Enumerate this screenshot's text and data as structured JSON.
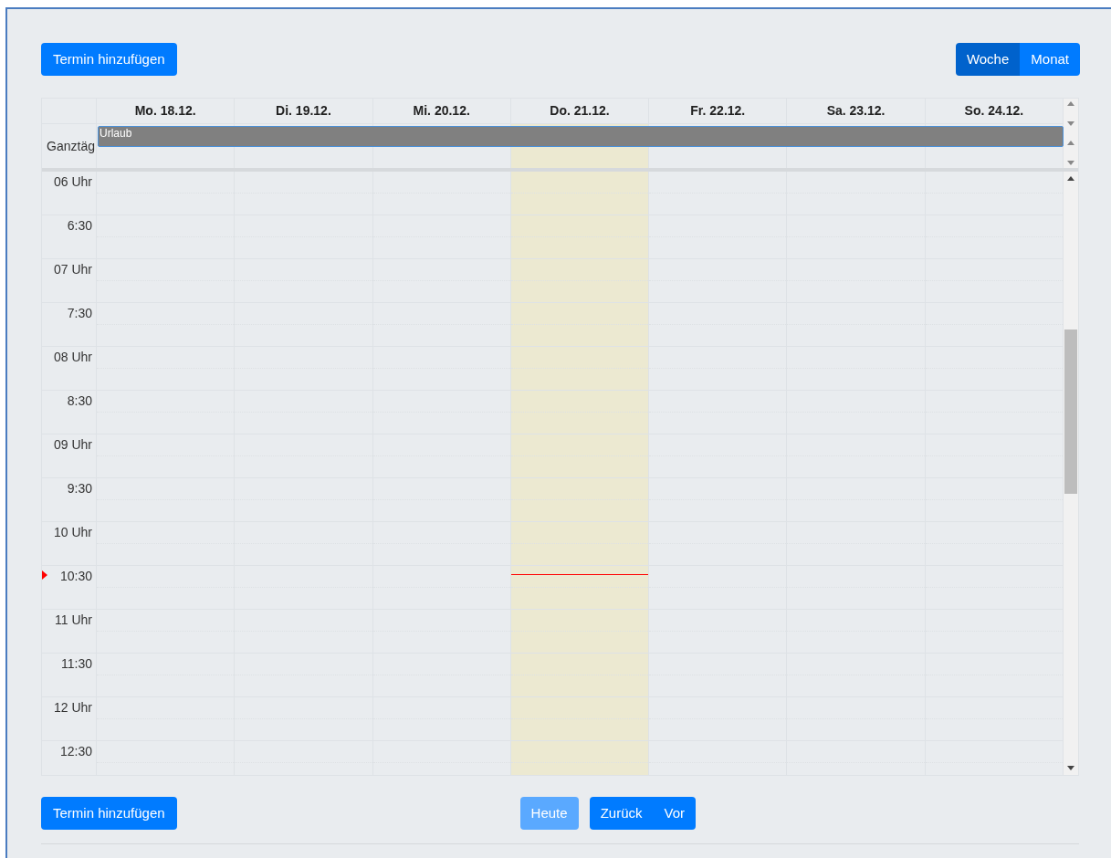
{
  "toolbar_top": {
    "add_button": "Termin hinzufügen",
    "views": [
      {
        "label": "Woche",
        "selected": true
      },
      {
        "label": "Monat",
        "selected": false
      }
    ]
  },
  "calendar": {
    "days": [
      {
        "label": "Mo. 18.12.",
        "today": false
      },
      {
        "label": "Di. 19.12.",
        "today": false
      },
      {
        "label": "Mi. 20.12.",
        "today": false
      },
      {
        "label": "Do. 21.12.",
        "today": true
      },
      {
        "label": "Fr. 22.12.",
        "today": false
      },
      {
        "label": "Sa. 23.12.",
        "today": false
      },
      {
        "label": "So. 24.12.",
        "today": false
      }
    ],
    "all_day_label": "Ganztäg",
    "all_day_events": [
      {
        "title": "Urlaub"
      }
    ],
    "slots": [
      {
        "label": "06 Uhr",
        "now": false
      },
      {
        "label": "6:30",
        "now": false
      },
      {
        "label": "07 Uhr",
        "now": false
      },
      {
        "label": "7:30",
        "now": false
      },
      {
        "label": "08 Uhr",
        "now": false
      },
      {
        "label": "8:30",
        "now": false
      },
      {
        "label": "09 Uhr",
        "now": false
      },
      {
        "label": "9:30",
        "now": false
      },
      {
        "label": "10 Uhr",
        "now": false
      },
      {
        "label": "10:30",
        "now": true
      },
      {
        "label": "11 Uhr",
        "now": false
      },
      {
        "label": "11:30",
        "now": false
      },
      {
        "label": "12 Uhr",
        "now": false
      },
      {
        "label": "12:30",
        "now": false
      }
    ]
  },
  "toolbar_bottom": {
    "add_button": "Termin hinzufügen",
    "today_button": {
      "label": "Heute",
      "disabled": true
    },
    "nav_buttons": [
      "Zurück",
      "Vor"
    ]
  }
}
